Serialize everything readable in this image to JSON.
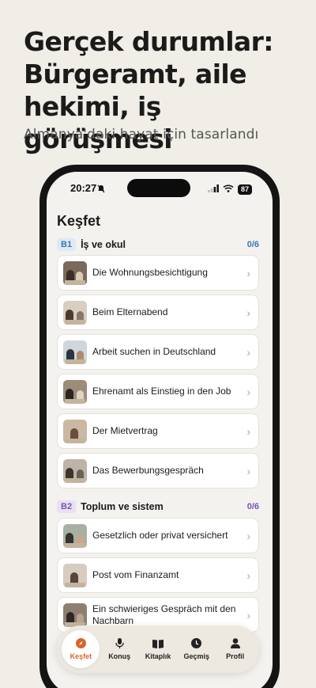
{
  "promo": {
    "headline": "Gerçek durumlar: Bürgeramt, aile hekimi, iş görüşmesi",
    "subtitle": "Almanya'daki hayat için tasarlandı"
  },
  "status_bar": {
    "time": "20:27",
    "battery": "87"
  },
  "screen": {
    "title": "Keşfet"
  },
  "sections": [
    {
      "level": "B1",
      "name": "İş ve okul",
      "progress": "0/6",
      "level_color": "#3b78b8",
      "level_bg": "#dde9f5",
      "items": [
        {
          "label": "Die Wohnungsbesichtigung"
        },
        {
          "label": "Beim Elternabend"
        },
        {
          "label": "Arbeit suchen in Deutschland"
        },
        {
          "label": "Ehrenamt als Einstieg in den Job"
        },
        {
          "label": "Der Mietvertrag"
        },
        {
          "label": "Das Bewerbungsgespräch"
        }
      ]
    },
    {
      "level": "B2",
      "name": "Toplum ve sistem",
      "progress": "0/6",
      "level_color": "#7a55b0",
      "level_bg": "#e9e0f3",
      "items": [
        {
          "label": "Gesetzlich oder privat versichert"
        },
        {
          "label": "Post vom Finanzamt"
        },
        {
          "label": "Ein schwieriges Gespräch mit den Nachbarn"
        }
      ]
    }
  ],
  "tabbar": {
    "tabs": [
      {
        "label": "Keşfet",
        "icon": "compass-icon",
        "active": true
      },
      {
        "label": "Konuş",
        "icon": "microphone-icon"
      },
      {
        "label": "Kitaplık",
        "icon": "book-icon"
      },
      {
        "label": "Geçmiş",
        "icon": "clock-icon"
      },
      {
        "label": "Profil",
        "icon": "person-icon"
      }
    ]
  },
  "colors": {
    "accent": "#d9652a",
    "background": "#f1ede7"
  }
}
